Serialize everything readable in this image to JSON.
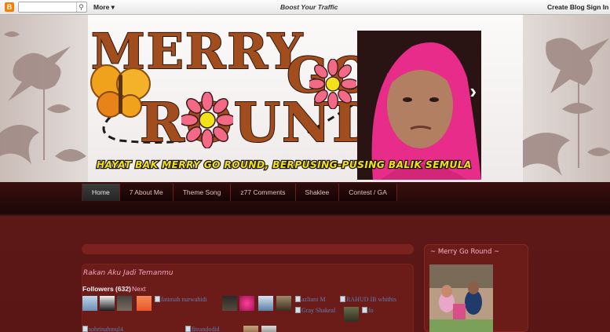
{
  "navbar": {
    "logo": "B",
    "search_value": "",
    "more": "More ▾",
    "boost": "Boost Your Traffic",
    "create_blog": "Create Blog",
    "sign_in": "Sign In"
  },
  "header": {
    "title_line1": "MERRY",
    "title_line2": "GO",
    "title_line3": "ROUND",
    "tagline": "HAYAT BAK MERRY GO ROUND, BERPUSING-PUSING BALIK SEMULA",
    "next_arrow": "›"
  },
  "menu": {
    "tabs": [
      {
        "label": "Home",
        "active": true
      },
      {
        "label": "7 About Me",
        "active": false
      },
      {
        "label": "Theme Song",
        "active": false
      },
      {
        "label": "z77 Comments",
        "active": false
      },
      {
        "label": "Shaklee",
        "active": false
      },
      {
        "label": "Contest / GA",
        "active": false
      }
    ]
  },
  "main": {
    "title": "Rakan Aku Jadi Temanmu",
    "followers_label": "Followers (632)",
    "followers_more": "Next",
    "broken_followers": [
      "fatimah nurwahidi",
      "azliani M",
      "RAHUD IB whithis",
      "Gray Shakeal",
      "fo",
      "sobrinahmul4",
      "fitrandodid"
    ]
  },
  "sidebar": {
    "title": "~ Merry Go Round ~"
  },
  "colors": {
    "title_fill": "#a24d1e",
    "title_outline": "#2c160b",
    "tagline": "#f2e21a",
    "panel": "#6b1b18",
    "accent_pink": "#f2a7c3",
    "blogger_orange": "#f57d00"
  }
}
